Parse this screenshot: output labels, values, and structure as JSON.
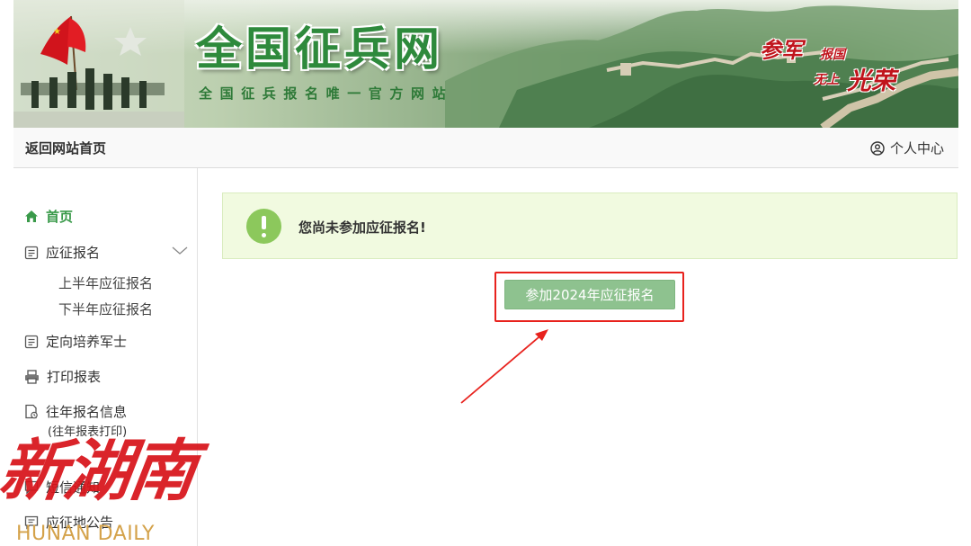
{
  "header": {
    "site_name": "全国征兵网",
    "site_tagline": "全国征兵报名唯一官方网站",
    "slogan": {
      "part1": "参军",
      "part2": "报国",
      "part3": "无上",
      "part4": "光荣"
    }
  },
  "nav": {
    "home_link": "返回网站首页",
    "user_center": "个人中心",
    "user_icon": "user-circle-icon"
  },
  "sidebar": {
    "items": [
      {
        "label": "首页",
        "icon": "home-icon",
        "active": true
      },
      {
        "label": "应征报名",
        "icon": "form-icon",
        "expanded": true,
        "children": [
          {
            "label": "上半年应征报名"
          },
          {
            "label": "下半年应征报名"
          }
        ]
      },
      {
        "label": "定向培养军士",
        "icon": "form-icon"
      },
      {
        "label": "打印报表",
        "icon": "printer-icon"
      },
      {
        "label": "往年报名信息",
        "icon": "history-doc-icon",
        "note": "(往年报表打印)"
      },
      {
        "label": "短信通知",
        "icon": "message-icon"
      },
      {
        "label": "应征地公告",
        "icon": "message-icon"
      }
    ]
  },
  "main": {
    "alert_icon": "exclamation-icon",
    "alert_message": "您尚未参加应征报名!",
    "join_button_label": "参加2024年应征报名"
  },
  "watermark": {
    "chinese": "新湖南",
    "english": "HUNAN DAILY"
  },
  "colors": {
    "accent_green": "#3a9a4a",
    "button_green": "#8ec28f",
    "alert_bg": "#f1fae0",
    "highlight_red": "#e8221d"
  }
}
